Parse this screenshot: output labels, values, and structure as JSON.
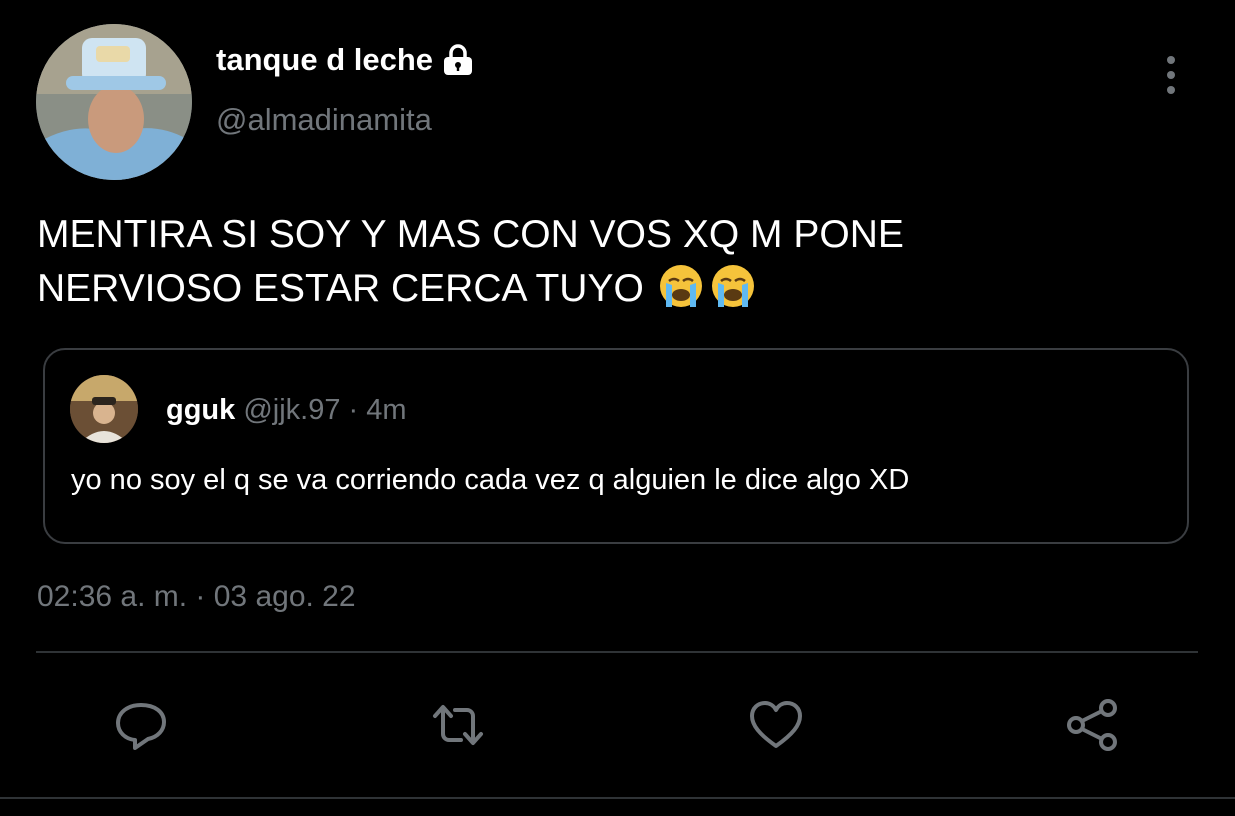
{
  "author": {
    "display_name": "tanque d leche",
    "handle": "@almadinamita",
    "protected": true
  },
  "tweet": {
    "text_line1": "MENTIRA SI SOY Y MAS CON VOS XQ M PONE",
    "text_line2": "NERVIOSO ESTAR CERCA TUYO",
    "emojis": [
      "loudly-crying-face",
      "loudly-crying-face"
    ]
  },
  "quoted_tweet": {
    "display_name": "gguk",
    "handle": "@jjk.97",
    "separator": "·",
    "time_ago": "4m",
    "text": "yo no soy el q se va corriendo cada vez q alguien le dice algo XD"
  },
  "timestamp": "02:36 a. m. · 03 ago. 22",
  "actions": [
    "reply-icon",
    "retweet-icon",
    "like-icon",
    "share-icon"
  ],
  "colors": {
    "background": "#000000",
    "text": "#ffffff",
    "secondary": "#71767b",
    "border": "#3a3d41"
  }
}
